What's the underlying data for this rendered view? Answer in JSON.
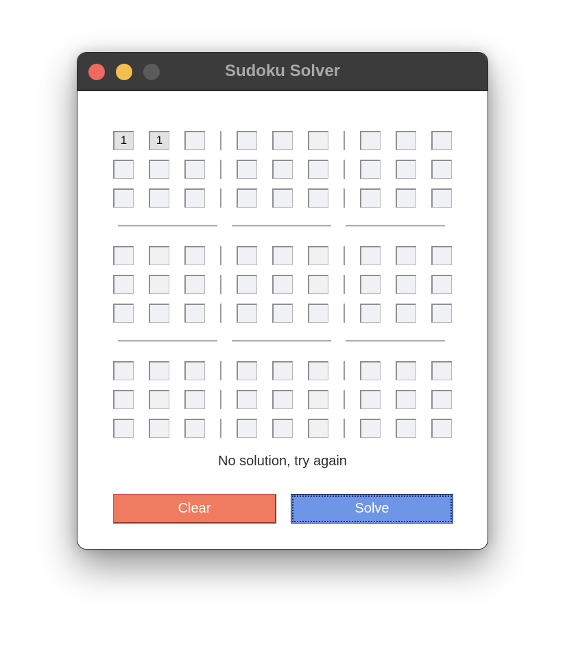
{
  "window": {
    "title": "Sudoku Solver",
    "controls": [
      "close",
      "minimize",
      "maximize"
    ]
  },
  "grid": {
    "rows": [
      [
        "1",
        "1",
        "",
        "",
        "",
        "",
        "",
        "",
        ""
      ],
      [
        "",
        "",
        "",
        "",
        "",
        "",
        "",
        "",
        ""
      ],
      [
        "",
        "",
        "",
        "",
        "",
        "",
        "",
        "",
        ""
      ],
      [
        "",
        "",
        "",
        "",
        "",
        "",
        "",
        "",
        ""
      ],
      [
        "",
        "",
        "",
        "",
        "",
        "",
        "",
        "",
        ""
      ],
      [
        "",
        "",
        "",
        "",
        "",
        "",
        "",
        "",
        ""
      ],
      [
        "",
        "",
        "",
        "",
        "",
        "",
        "",
        "",
        ""
      ],
      [
        "",
        "",
        "",
        "",
        "",
        "",
        "",
        "",
        ""
      ],
      [
        "",
        "",
        "",
        "",
        "",
        "",
        "",
        "",
        ""
      ]
    ]
  },
  "status": {
    "message": "No solution, try again"
  },
  "buttons": {
    "clear_label": "Clear",
    "solve_label": "Solve"
  },
  "colors": {
    "clear_button": "#ef7b61",
    "solve_button": "#6f96e6",
    "title_bar": "#3b3b3b"
  }
}
